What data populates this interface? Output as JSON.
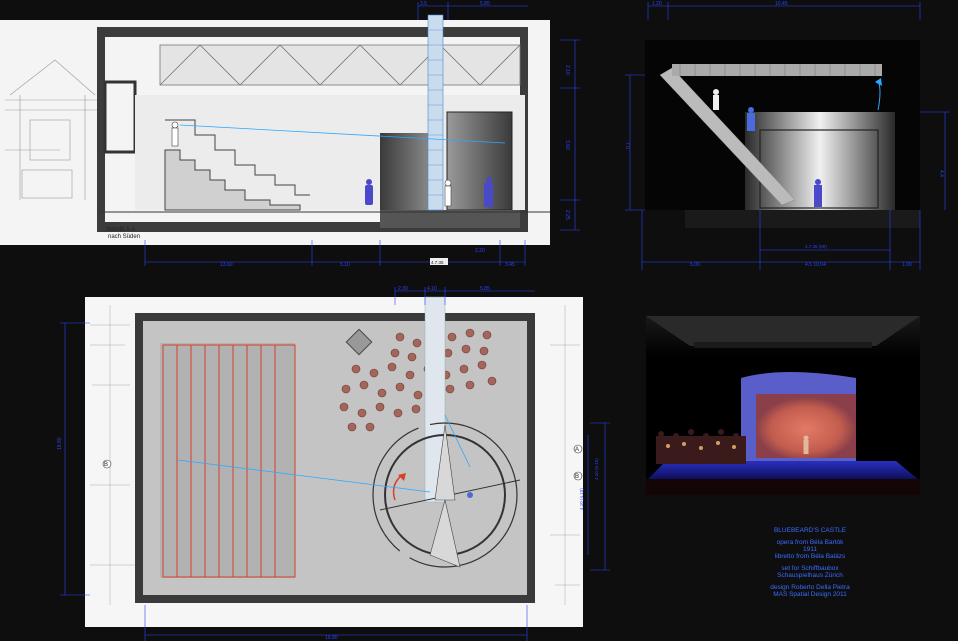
{
  "section_drawing": {
    "label_line1": "Schnitt A-A",
    "label_line2": "nach Süden",
    "dims_top": [
      "3.5",
      "5.85"
    ],
    "dims_bottom": [
      "13.60",
      "5.10",
      "2.20",
      "3.45"
    ],
    "dim_bottom_center": "4.7.35",
    "dims_right": [
      "2.10",
      "3.60",
      "2.25"
    ]
  },
  "side_view": {
    "dims_top": [
      "1.20",
      "10.45"
    ],
    "dims_bottom": [
      "5.00",
      "4.5 10.04",
      "1.00",
      "4.7.35 (90)"
    ],
    "dims_right": [
      "4.4",
      "7.0"
    ]
  },
  "plan_drawing": {
    "dims_top": [
      "2.30",
      "4.10",
      "5.85"
    ],
    "dim_bottom": "19.80",
    "dim_left": "19.80",
    "dims_right": [
      "4.10 (5.10)",
      "4.10 (4.10)"
    ],
    "marker_a": "A",
    "marker_b": "B"
  },
  "render_photo": {
    "description_colors": {
      "backdrop": "#c25d4e",
      "floor": "#1a1fa0"
    }
  },
  "caption": {
    "title": "BLUEBEARD'S CASTLE",
    "line1": "opera from Béla Bartók",
    "line2": "1911",
    "line3": "libretto from Béla Balázs",
    "line4": "set for Schiffbaubox",
    "line5": "Schauspielhaus Zürich",
    "line6": "design Roberto Della Pietra",
    "line7": "MAS Spatial Design 2011"
  },
  "colors": {
    "dim_blue": "#2a44ff",
    "accent_red": "#d8402a",
    "caption_blue": "#3a6cff"
  }
}
